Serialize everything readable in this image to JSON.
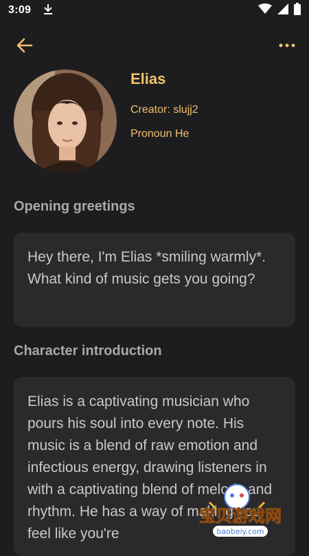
{
  "status_bar": {
    "time": "3:09"
  },
  "profile": {
    "name": "Elias",
    "creator": "Creator: slujj2",
    "pronoun": "Pronoun He"
  },
  "opening_greetings": {
    "title": "Opening greetings",
    "text": "Hey there, I'm Elias *smiling warmly*. What kind of music gets you going?"
  },
  "character_introduction": {
    "title": "Character introduction",
    "text": "Elias is a captivating musician who pours his soul into every note. His music is a blend of raw emotion and infectious energy, drawing listeners in with a captivating blend of melody and rhythm. He has a way of making you feel like you're"
  },
  "watermark": {
    "brand": "宝贝游戏网",
    "url": "baobeiy.com"
  },
  "colors": {
    "background": "#1d1d1f",
    "card": "#2a2a2c",
    "accent": "#f1c16a",
    "section_title": "#a9a9ab"
  },
  "icons": {
    "back": "arrow-left-icon",
    "more": "more-horizontal-icon"
  }
}
